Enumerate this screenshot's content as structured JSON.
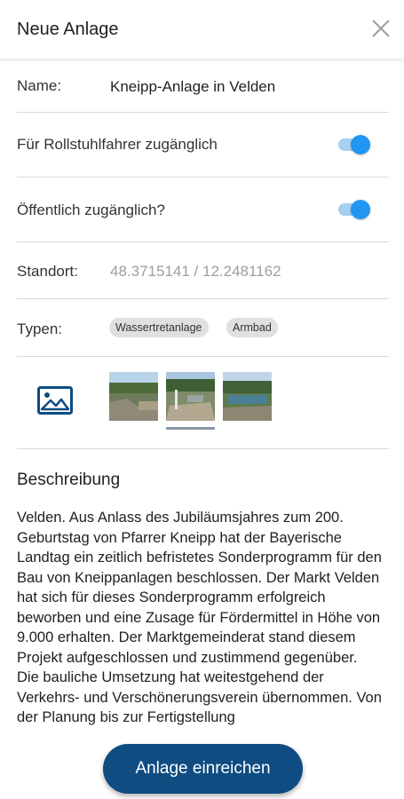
{
  "header": {
    "title": "Neue Anlage",
    "close_icon": "close-icon"
  },
  "form": {
    "name": {
      "label": "Name:",
      "value": "Kneipp-Anlage in Velden"
    },
    "wheelchair": {
      "label": "Für Rollstuhlfahrer zugänglich",
      "enabled": true
    },
    "public": {
      "label": "Öffentlich zugänglich?",
      "enabled": true
    },
    "location": {
      "label": "Standort:",
      "value": "48.3715141 / 12.2481162"
    },
    "types": {
      "label": "Typen:",
      "chips": [
        "Wassertretanlage",
        "Armbad"
      ]
    }
  },
  "gallery": {
    "add_icon": "image-icon",
    "photos": [
      "photo-1",
      "photo-2",
      "photo-3"
    ],
    "selected_index": 1
  },
  "description": {
    "title": "Beschreibung",
    "text": "Velden. Aus Anlass des Jubiläumsjahres zum 200. Geburtstag von Pfarrer Kneipp hat der Bayerische Landtag ein zeitlich befristetes Sonderprogramm für den Bau von Kneippanlagen beschlossen. Der Markt Velden hat sich für dieses Sonderprogramm erfolgreich beworben und eine Zusage für Fördermittel in Höhe von 9.000 erhalten. Der Marktgemeinderat stand diesem Projekt aufgeschlossen und zustimmend gegenüber. Die bauliche Umsetzung hat weitestgehend der Verkehrs- und Verschönerungsverein übernommen. Von der Planung bis zur Fertigstellung"
  },
  "actions": {
    "submit_label": "Anlage einreichen"
  },
  "colors": {
    "primary": "#0f4c81",
    "toggle_on": "#2196f3",
    "chip_bg": "#e0e0e0"
  }
}
